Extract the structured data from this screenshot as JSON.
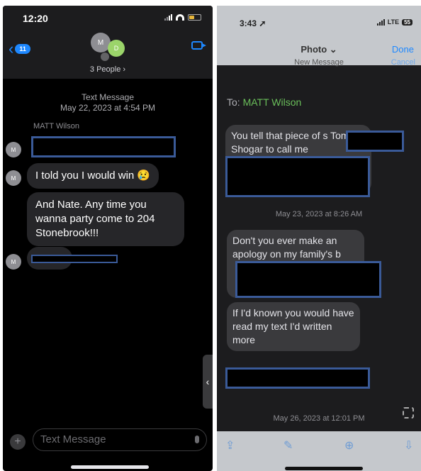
{
  "left": {
    "status": {
      "time": "12:20"
    },
    "header": {
      "back_badge": "11",
      "people_label": "3 People ›",
      "avatar_initial": "M",
      "avatar2_initial": "D"
    },
    "thread": {
      "service": "Text Message",
      "timestamp": "May 22, 2023 at 4:54 PM",
      "sender": "MATT Wilson",
      "messages": [
        {
          "text": ""
        },
        {
          "text": "I told you I would win 😢"
        },
        {
          "text": "And Nate.  Any time you wanna party come to 204 Stonebrook!!!"
        },
        {
          "text": ""
        }
      ]
    },
    "composer": {
      "placeholder": "Text Message"
    }
  },
  "right": {
    "status": {
      "time": "3:43",
      "network": "LTE",
      "battery": "55"
    },
    "header": {
      "title": "Photo ⌄",
      "done": "Done",
      "new_message": "New Message",
      "cancel": "Cancel"
    },
    "to_label": "To:",
    "to_name": "MATT Wilson",
    "messages": [
      {
        "text": "You tell that piece of s Tom Shogar to call me"
      },
      {
        "text": "Don't you ever make an apology on my family's b"
      },
      {
        "text": "If I'd known you would have read my text I'd written more"
      }
    ],
    "dates": [
      "May 23, 2023 at 8:26 AM",
      "May 26, 2023 at 12:01 PM"
    ]
  },
  "colors": {
    "imessage_blue": "#1e88ff",
    "redaction_outline": "#3a5a98",
    "contact_green": "#6abf5a"
  }
}
